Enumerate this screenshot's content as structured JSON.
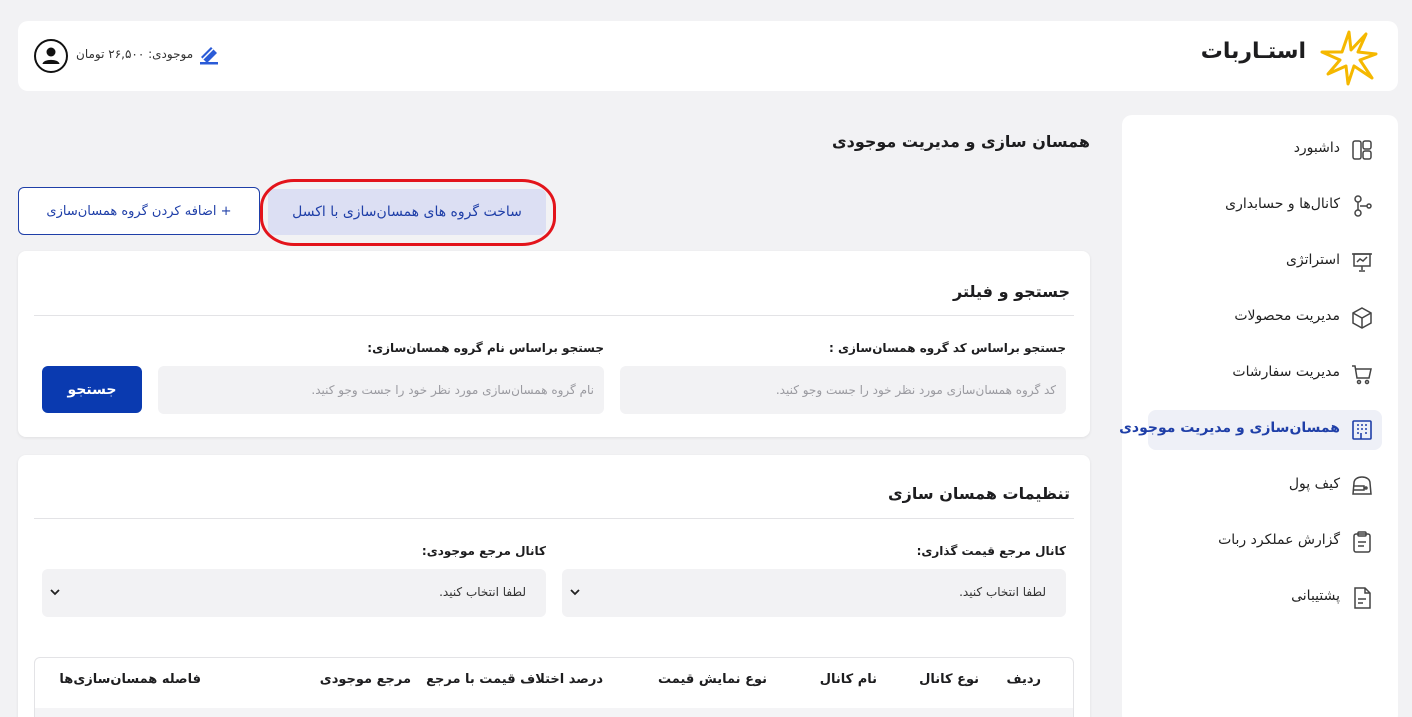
{
  "header": {
    "logo_text": "استـاربات",
    "balance": "موجودی: ۲۶,۵۰۰ تومان"
  },
  "sidebar": {
    "items": [
      {
        "label": "داشبورد",
        "icon": "dashboard-icon"
      },
      {
        "label": "کانال‌ها و حسابداری",
        "icon": "channels-icon"
      },
      {
        "label": "استراتژی",
        "icon": "strategy-icon"
      },
      {
        "label": "مدیریت محصولات",
        "icon": "box-icon"
      },
      {
        "label": "مدیریت سفارشات",
        "icon": "cart-icon"
      },
      {
        "label": "همسان‌سازی و مدیریت موجودی",
        "icon": "building-icon"
      },
      {
        "label": "کیف پول",
        "icon": "wallet-icon"
      },
      {
        "label": "گزارش عملکرد ربات",
        "icon": "clipboard-icon"
      },
      {
        "label": "پشتیبانی",
        "icon": "document-icon"
      }
    ]
  },
  "page": {
    "title": "همسان سازی و مدیریت موجودی",
    "add_group_label": "+ اضافه کردن گروه همسان‌سازی",
    "excel_label": "ساخت گروه های همسان‌سازی با اکسل"
  },
  "search": {
    "title": "جستجو و فیلتر",
    "code_label": "جستجو براساس کد گروه همسان‌سازی :",
    "code_placeholder": "کد گروه همسان‌سازی مورد نظر خود را جست وجو کنید.",
    "name_label": "جستجو براساس نام گروه همسان‌سازی:",
    "name_placeholder": "نام گروه همسان‌سازی مورد نظر خود را جست وجو کنید.",
    "button": "جستجو"
  },
  "settings": {
    "title": "تنظیمات همسان سازی",
    "pricing_label": "کانال مرجع قیمت گذاری:",
    "pricing_value": "لطفا انتخاب کنید.",
    "inventory_label": "کانال مرجع موجودی:",
    "inventory_value": "لطفا انتخاب کنید."
  },
  "table": {
    "columns": [
      "ردیف",
      "نوع کانال",
      "نام کانال",
      "نوع نمایش قیمت",
      "درصد اختلاف قیمت با مرجع",
      "مرجع موجودی",
      "فاصله همسان‌سازی‌ها"
    ]
  },
  "colors": {
    "primary": "#0a3ab0",
    "accent_blue": "#1f3fa8",
    "highlight": "#e3141b",
    "logo_yellow": "#f5b800"
  }
}
